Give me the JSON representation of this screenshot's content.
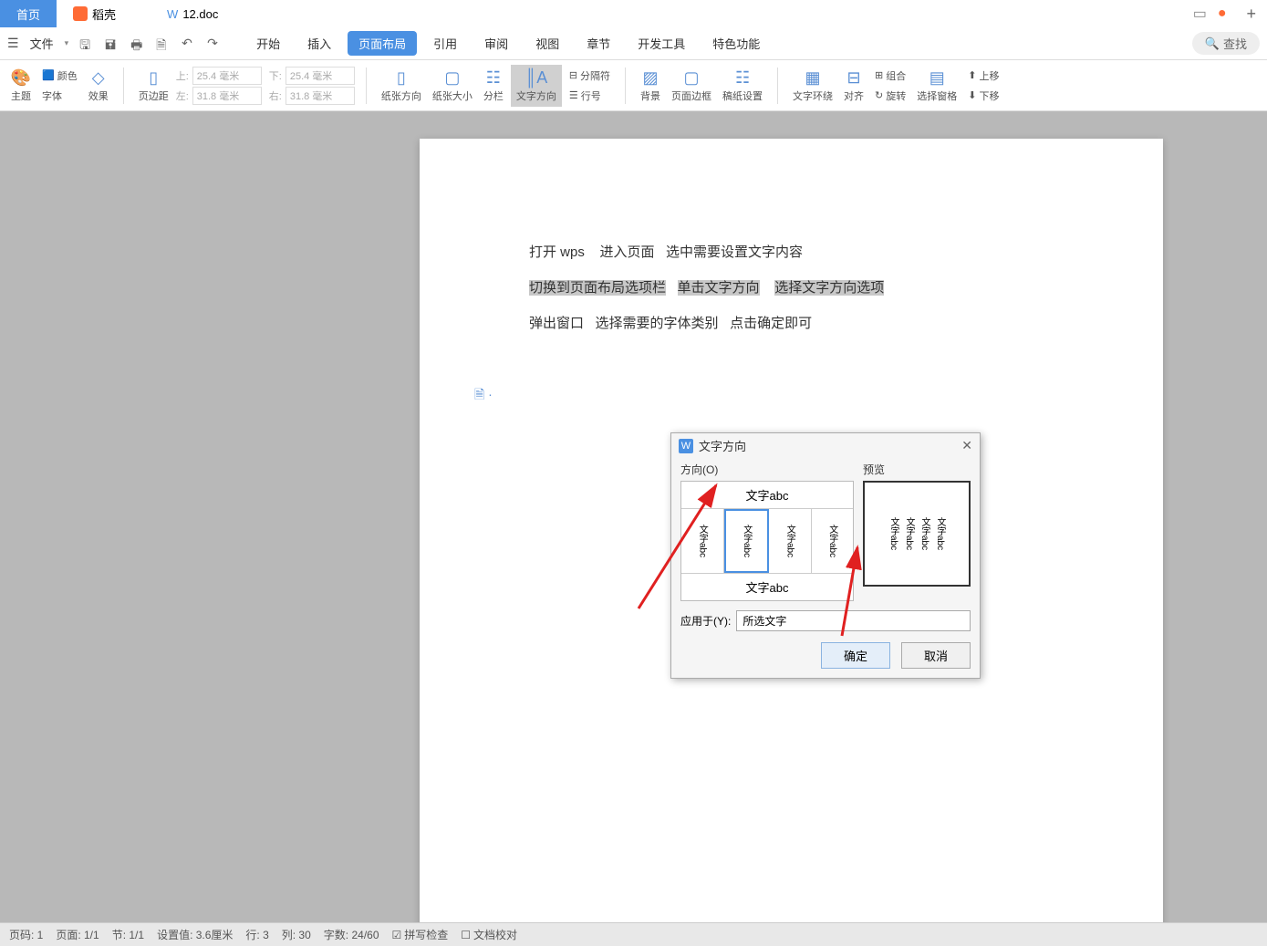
{
  "tabs": {
    "home": "首页",
    "daoke": "稻壳",
    "doc": "12.doc",
    "doc_icon": "W"
  },
  "menubar": {
    "file": "文件",
    "tabs": [
      "开始",
      "插入",
      "页面布局",
      "引用",
      "审阅",
      "视图",
      "章节",
      "开发工具",
      "特色功能"
    ],
    "active_tab": "页面布局",
    "search": "查找"
  },
  "ribbon": {
    "theme": "主题",
    "color": "颜色",
    "font": "字体",
    "effect": "效果",
    "page_margin": "页边距",
    "margins": {
      "top_label": "上:",
      "top_val": "25.4 毫米",
      "bottom_label": "下:",
      "bottom_val": "25.4 毫米",
      "left_label": "左:",
      "left_val": "31.8 毫米",
      "right_label": "右:",
      "right_val": "31.8 毫米"
    },
    "paper_dir": "纸张方向",
    "paper_size": "纸张大小",
    "columns": "分栏",
    "text_dir": "文字方向",
    "separator": "分隔符",
    "line_num": "行号",
    "background": "背景",
    "page_border": "页面边框",
    "draft_paper": "稿纸设置",
    "text_wrap": "文字环绕",
    "align": "对齐",
    "group": "组合",
    "rotate": "旋转",
    "select_pane": "选择窗格",
    "move_up": "上移",
    "move_down": "下移"
  },
  "document": {
    "line1_a": "打开 wps",
    "line1_b": "进入页面",
    "line1_c": "选中需要设置文字内容",
    "line2_a": "切换到页面布局选项栏",
    "line2_b": "单击文字方向",
    "line2_c": "选择文字方向选项",
    "line3_a": "弹出窗口",
    "line3_b": "选择需要的字体类别",
    "line3_c": "点击确定即可"
  },
  "dialog": {
    "title": "文字方向",
    "direction_label": "方向(O)",
    "preview_label": "预览",
    "sample": "文字abc",
    "sample_rot": "文字abc",
    "apply_label": "应用于(Y):",
    "apply_value": "所选文字",
    "ok": "确定",
    "cancel": "取消"
  },
  "statusbar": {
    "page_code": "页码: 1",
    "page": "页面: 1/1",
    "section": "节: 1/1",
    "setting": "设置值: 3.6厘米",
    "row": "行: 3",
    "col": "列: 30",
    "words": "字数: 24/60",
    "spellcheck": "拼写检查",
    "proofread": "文档校对"
  }
}
